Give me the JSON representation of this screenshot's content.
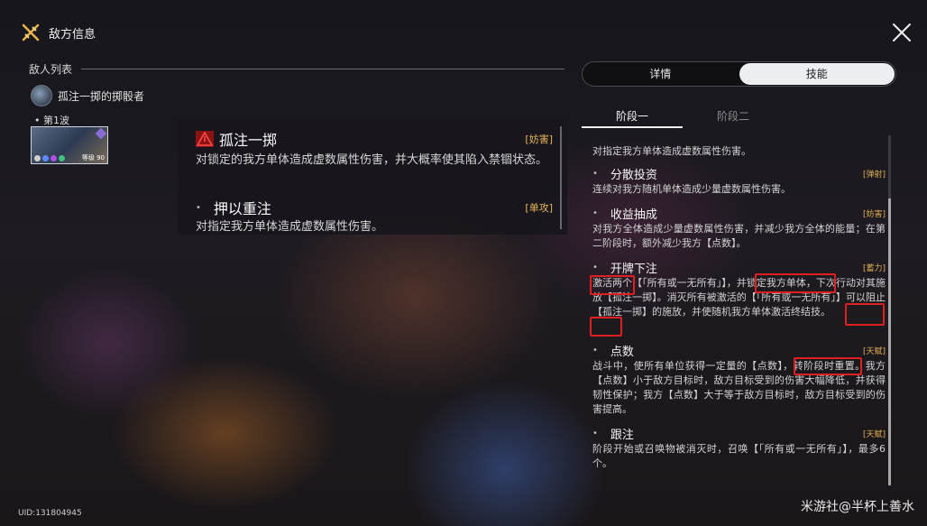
{
  "header": {
    "title": "敌方信息",
    "icon": "sword-cross-icon",
    "close_icon": "close-icon"
  },
  "enemy_list": {
    "label": "敌人列表",
    "enemy_name": "孤注一掷的掷骰者",
    "wave_label": "• 第1波",
    "wave_level": "等级 90"
  },
  "popup": {
    "skills": [
      {
        "name": "孤注一掷",
        "tag": "[妨害]",
        "desc": "对锁定的我方单体造成虚数属性伤害，并大概率使其陷入禁锢状态。"
      },
      {
        "name": "押以重注",
        "tag": "[单攻]",
        "desc": "对指定我方单体造成虚数属性伤害。"
      }
    ]
  },
  "tabs": {
    "details": "详情",
    "skills": "技能",
    "active": "skills"
  },
  "stage_tabs": {
    "stage1": "阶段一",
    "stage2": "阶段二",
    "active": "stage1"
  },
  "skill_list": [
    {
      "name": "",
      "tag": "",
      "desc": "对指定我方单体造成虚数属性伤害。"
    },
    {
      "name": "分散投资",
      "tag": "[弹射]",
      "desc": "连续对我方随机单体造成少量虚数属性伤害。"
    },
    {
      "name": "收益抽成",
      "tag": "[妨害]",
      "desc": "对我方全体造成少量虚数属性伤害，并减少我方全体的能量；在第二阶段时，额外减少我方【点数】。"
    },
    {
      "name": "开牌下注",
      "tag": "[蓄力]",
      "desc": "激活两个【「所有或一无所有」】，并锁定我方单体，下次行动对其施放【孤注一掷】。消灭所有被激活的【「所有或一无所有」】可以阻止【孤注一掷】的施放，并使随机我方单体激活终结技。"
    },
    {
      "name": "点数",
      "tag": "[天赋]",
      "desc": "战斗中，使所有单位获得一定量的【点数】，转阶段时重置。我方【点数】小于敌方目标时，敌方目标受到的伤害大幅降低，并获得韧性保护；我方【点数】大于等于敌方目标时，敌方目标受到的伤害提高。"
    },
    {
      "name": "跟注",
      "tag": "[天赋]",
      "desc": "阶段开始或召唤物被消灭时，召唤【「所有或一无所有」】，最多6个。"
    }
  ],
  "footer": {
    "uid": "UID:131804945",
    "watermark": "米游社@半杯上善水"
  },
  "colors": {
    "tag": "#e0ad52",
    "highlight_box": "#e02020",
    "active_tab_bg": "#eceef1"
  }
}
